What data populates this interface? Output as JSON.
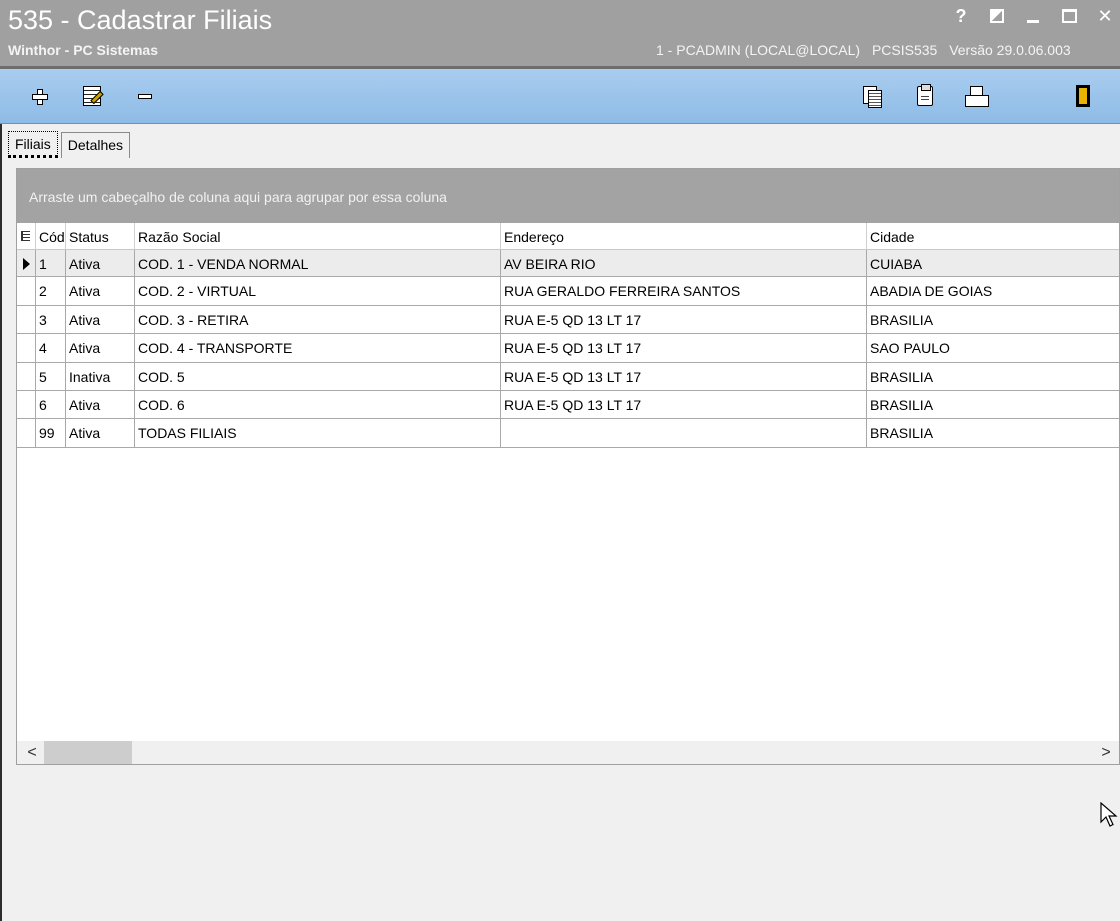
{
  "window": {
    "title": "535 - Cadastrar Filiais",
    "subtitle": "Winthor - PC Sistemas",
    "session": {
      "user": "1 - PCADMIN (LOCAL@LOCAL)",
      "routine": "PCSIS535",
      "version": "Versão 29.0.06.003"
    },
    "help_label": "?",
    "close_label": "✕"
  },
  "toolbar": {
    "buttons": [
      "add-icon",
      "edit-icon",
      "remove-icon",
      "copy-icon",
      "clipboard-icon",
      "print-icon",
      "exit-icon"
    ]
  },
  "tabs": [
    {
      "label": "Filiais",
      "active": true
    },
    {
      "label": "Detalhes",
      "active": false
    }
  ],
  "grid": {
    "group_panel_text": "Arraste um cabeçalho de coluna aqui para agrupar por essa coluna",
    "columns": [
      "Código",
      "Status",
      "Razão Social",
      "Endereço",
      "Cidade"
    ],
    "rows": [
      [
        "1",
        "Ativa",
        "COD. 1 - VENDA NORMAL",
        "AV BEIRA RIO",
        "CUIABA"
      ],
      [
        "2",
        "Ativa",
        "COD. 2 - VIRTUAL",
        "RUA GERALDO FERREIRA SANTOS",
        "ABADIA DE GOIAS"
      ],
      [
        "3",
        "Ativa",
        "COD. 3 - RETIRA",
        "RUA E-5 QD 13 LT 17",
        "BRASILIA"
      ],
      [
        "4",
        "Ativa",
        "COD. 4 - TRANSPORTE",
        "RUA E-5 QD 13 LT 17",
        "SAO PAULO"
      ],
      [
        "5",
        "Inativa",
        "COD. 5",
        "RUA E-5 QD 13 LT 17",
        "BRASILIA"
      ],
      [
        "6",
        "Ativa",
        "COD. 6",
        "RUA E-5 QD 13 LT 17",
        "BRASILIA"
      ],
      [
        "99",
        "Ativa",
        "TODAS FILIAIS",
        "",
        "BRASILIA"
      ]
    ],
    "selected_row": 0,
    "scroll_left_label": "<",
    "scroll_right_label": ">"
  }
}
